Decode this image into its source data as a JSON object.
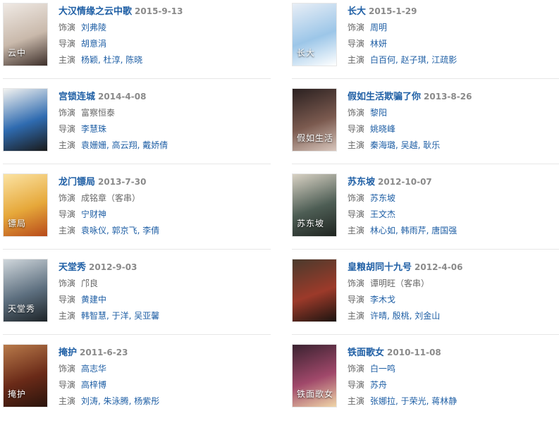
{
  "labels": {
    "role": "饰演",
    "director": "导演",
    "cast": "主演"
  },
  "items": [
    {
      "title": "大汉情缘之云中歌",
      "date": "2015-9-13",
      "role": "刘弗陵",
      "role_link": true,
      "director": "胡意涓",
      "cast": "杨颖, 杜淳, 陈晓",
      "poster_colors": [
        "#efe9e4",
        "#c9b9ab",
        "#3d2f2a"
      ],
      "poster_caption": "云中"
    },
    {
      "title": "长大",
      "date": "2015-1-29",
      "role": "周明",
      "role_link": true,
      "director": "林妍",
      "cast": "白百何, 赵子琪, 江疏影",
      "poster_colors": [
        "#e8eef6",
        "#9cc6e8",
        "#ffffff"
      ],
      "poster_caption": "长大"
    },
    {
      "title": "宫锁连城",
      "date": "2014-4-08",
      "role": "富察恒泰",
      "role_link": false,
      "director": "李慧珠",
      "cast": "袁姗姗, 高云翔, 戴娇倩",
      "poster_colors": [
        "#f2f2f0",
        "#2f6bb0",
        "#1a1a1a"
      ],
      "poster_caption": ""
    },
    {
      "title": "假如生活欺骗了你",
      "date": "2013-8-26",
      "role": "黎阳",
      "role_link": true,
      "director": "姚晓峰",
      "cast": "秦海璐, 吴越, 耿乐",
      "poster_colors": [
        "#2a2020",
        "#7b5a4f",
        "#d9c7bd"
      ],
      "poster_caption": "假如生活"
    },
    {
      "title": "龙门镖局",
      "date": "2013-7-30",
      "role": "成铭章（客串）",
      "role_link": false,
      "director": "宁财神",
      "cast": "袁咏仪, 郭京飞, 李倩",
      "poster_colors": [
        "#fbe3a3",
        "#e6a83a",
        "#b84a1a"
      ],
      "poster_caption": "镖局"
    },
    {
      "title": "苏东坡",
      "date": "2012-10-07",
      "role": "苏东坡",
      "role_link": true,
      "director": "王文杰",
      "cast": "林心如, 韩雨芹, 唐国强",
      "poster_colors": [
        "#d9d2c4",
        "#4d5d54",
        "#1f2420"
      ],
      "poster_caption": "苏东坡"
    },
    {
      "title": "天堂秀",
      "date": "2012-9-03",
      "role": "邝良",
      "role_link": false,
      "director": "黄建中",
      "cast": "韩智慧, 于洋, 吴亚馨",
      "poster_colors": [
        "#cfd6db",
        "#5d6f7f",
        "#1d2327"
      ],
      "poster_caption": "天堂秀"
    },
    {
      "title": "皇粮胡同十九号",
      "date": "2012-4-06",
      "role": "谭明旺（客串）",
      "role_link": false,
      "director": "李木戈",
      "cast": "许晴, 殷桃, 刘金山",
      "poster_colors": [
        "#4a3a2c",
        "#9c3a2a",
        "#1c1410"
      ],
      "poster_caption": ""
    },
    {
      "title": "掩护",
      "date": "2011-6-23",
      "role": "高志华",
      "role_link": true,
      "director": "高梓博",
      "cast": "刘涛, 朱泳腾, 杨紫彤",
      "poster_colors": [
        "#b87a4a",
        "#6a2a18",
        "#2a140c"
      ],
      "poster_caption": "掩护"
    },
    {
      "title": "铁面歌女",
      "date": "2010-11-08",
      "role": "白一鸣",
      "role_link": true,
      "director": "苏舟",
      "cast": "张娜拉, 于荣光, 蒋林静",
      "poster_colors": [
        "#3a2230",
        "#a0486a",
        "#f0d6a8"
      ],
      "poster_caption": "铁面歌女"
    }
  ]
}
